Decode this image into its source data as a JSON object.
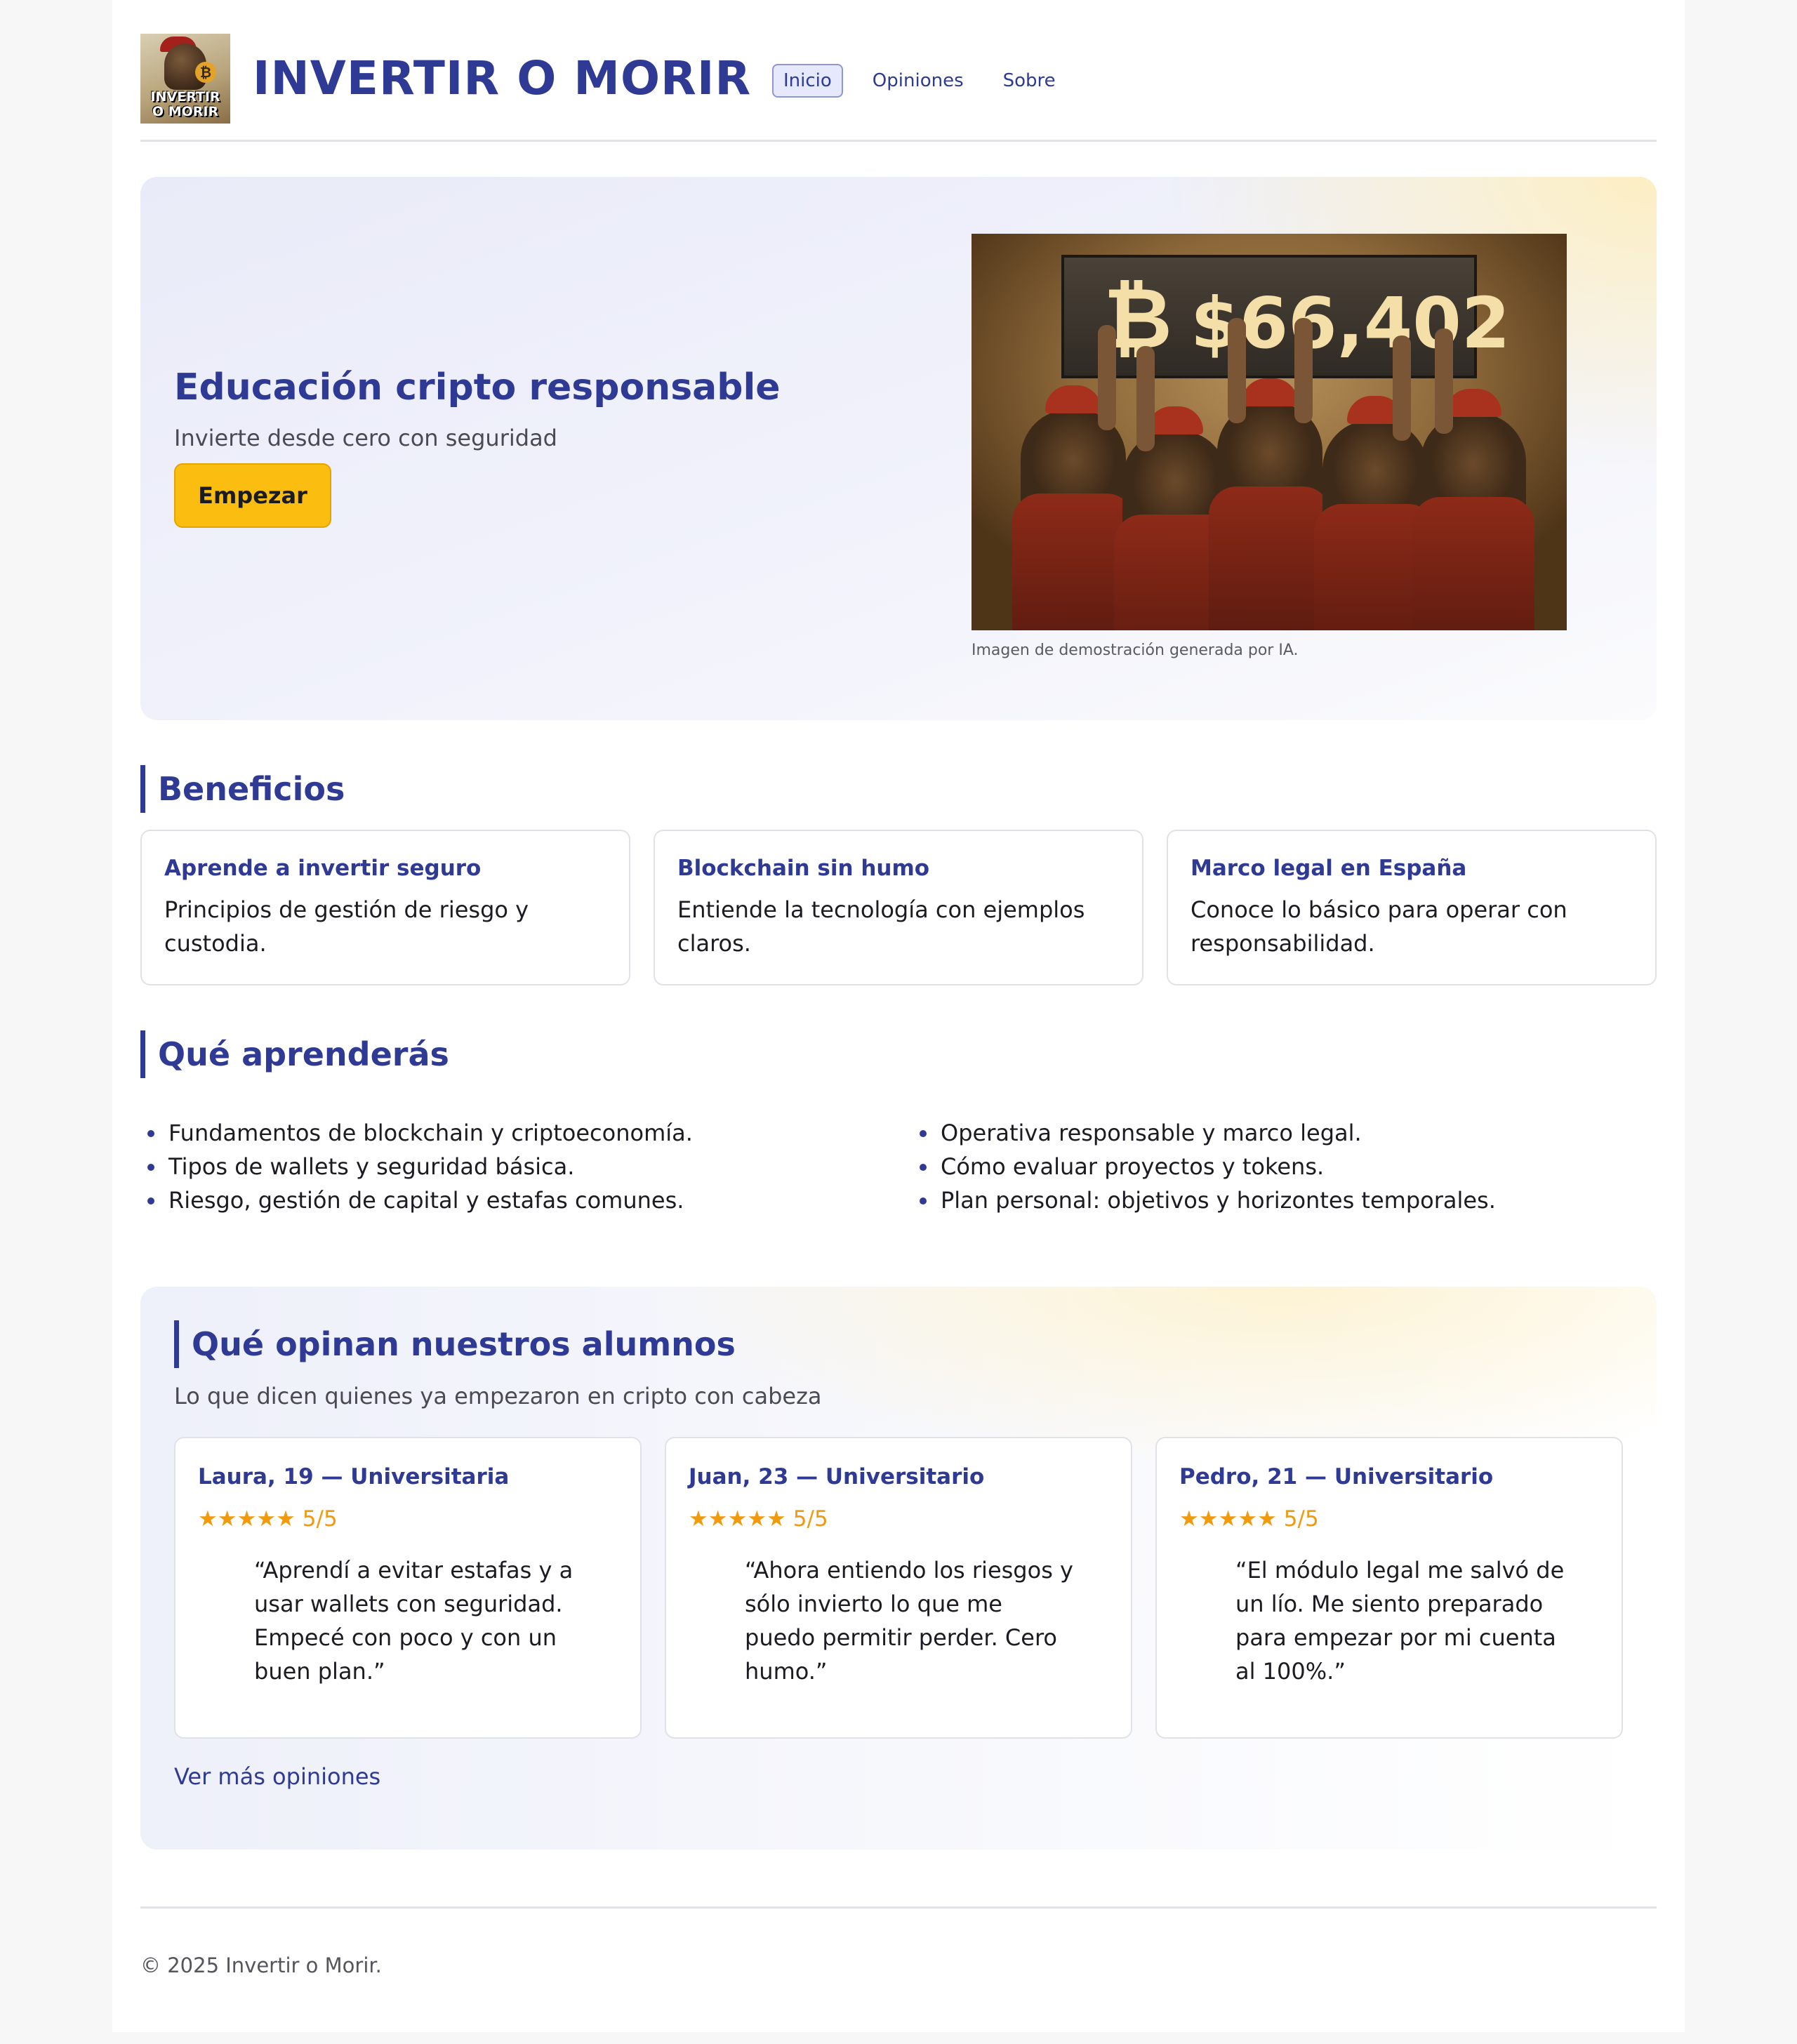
{
  "header": {
    "logo_text": "INVERTIR O MORIR",
    "title": "INVERTIR O MORIR",
    "nav": [
      {
        "label": "Inicio",
        "active": true
      },
      {
        "label": "Opiniones",
        "active": false
      },
      {
        "label": "Sobre",
        "active": false
      }
    ]
  },
  "hero": {
    "title": "Educación cripto responsable",
    "subtitle": "Invierte desde cero con seguridad",
    "cta_label": "Empezar",
    "image": {
      "sign_symbol": "₿",
      "sign_price": "$66,402",
      "caption": "Imagen de demostración generada por IA."
    }
  },
  "benefits": {
    "heading": "Beneficios",
    "cards": [
      {
        "title": "Aprende a invertir seguro",
        "text": "Principios de gestión de riesgo y custodia."
      },
      {
        "title": "Blockchain sin humo",
        "text": "Entiende la tecnología con ejemplos claros."
      },
      {
        "title": "Marco legal en España",
        "text": "Conoce lo básico para operar con responsabilidad."
      }
    ]
  },
  "learn": {
    "heading": "Qué aprenderás",
    "left": [
      "Fundamentos de blockchain y criptoeconomía.",
      "Tipos de wallets y seguridad básica.",
      "Riesgo, gestión de capital y estafas comunes."
    ],
    "right": [
      "Operativa responsable y marco legal.",
      "Cómo evaluar proyectos y tokens.",
      "Plan personal: objetivos y horizontes temporales."
    ]
  },
  "testimonials": {
    "heading": "Qué opinan nuestros alumnos",
    "lead": "Lo que dicen quienes ya empezaron en cripto con cabeza",
    "items": [
      {
        "author": "Laura, 19 — Universitaria",
        "rating": "★★★★★ 5/5",
        "quote": "“Aprendí a evitar estafas y a usar wallets con seguridad. Empecé con poco y con un buen plan.”"
      },
      {
        "author": "Juan, 23 — Universitario",
        "rating": "★★★★★ 5/5",
        "quote": "“Ahora entiendo los riesgos y sólo invierto lo que me puedo permitir perder. Cero humo.”"
      },
      {
        "author": "Pedro, 21 — Universitario",
        "rating": "★★★★★ 5/5",
        "quote": "“El módulo legal me salvó de un lío. Me siento preparado para empezar por mi cuenta al 100%.”"
      }
    ],
    "more_link": "Ver más opiniones"
  },
  "footer": {
    "copyright": "© 2025 Invertir o Morir."
  },
  "colors": {
    "brand": "#2e3a94",
    "accent": "#fbbd0f",
    "stars": "#f29a0d"
  }
}
